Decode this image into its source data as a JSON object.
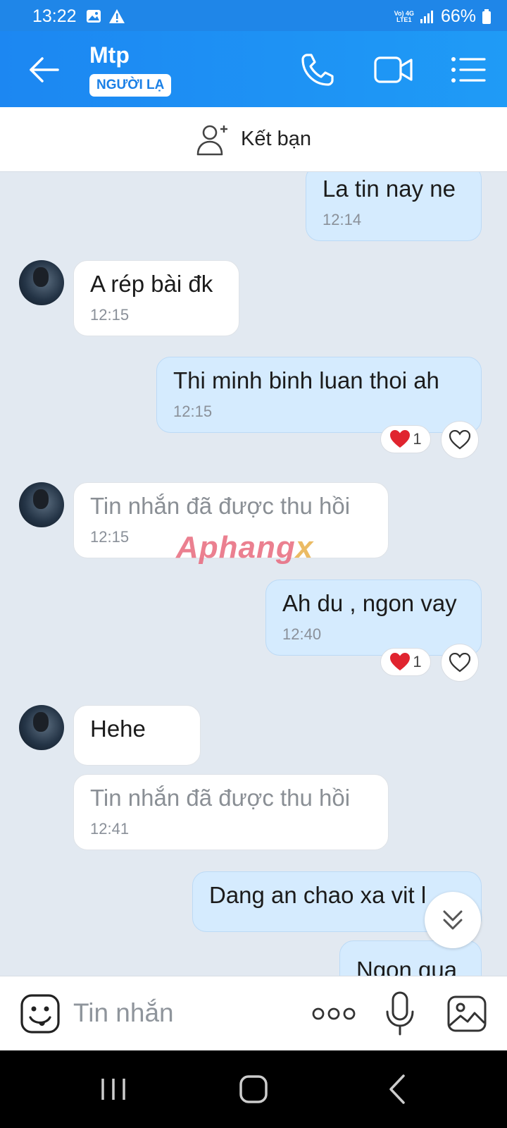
{
  "status_bar": {
    "time": "13:22",
    "net_line1": "Vo) 4G",
    "net_line2": "LTE1",
    "battery": "66%"
  },
  "header": {
    "contact_name": "Mtp",
    "badge": "NGƯỜI LẠ",
    "colors": {
      "header_bg": "#1f8ff0",
      "sent_bubble": "#d5ebfe",
      "received_bubble": "#ffffff",
      "chat_bg": "#e2e9f1"
    }
  },
  "friend_bar": {
    "label": "Kết bạn"
  },
  "messages": [
    {
      "direction": "sent",
      "text": "La tin nay ne",
      "time": "12:14"
    },
    {
      "direction": "received",
      "text": "A rép bài đk",
      "time": "12:15"
    },
    {
      "direction": "sent",
      "text": "Thi minh binh luan thoi ah",
      "time": "12:15",
      "reaction_count": "1"
    },
    {
      "direction": "received",
      "text": "Tin nhắn đã được thu hồi",
      "time": "12:15"
    },
    {
      "direction": "sent",
      "text": "Ah du , ngon vay",
      "time": "12:40",
      "reaction_count": "1"
    },
    {
      "direction": "received",
      "text": "Hehe",
      "time": ""
    },
    {
      "direction": "received",
      "text": "Tin nhắn đã được thu hồi",
      "time": "12:41"
    },
    {
      "direction": "sent",
      "text": "Dang an chao xa vit l",
      "time": ""
    },
    {
      "direction": "sent",
      "text": "Ngon qua",
      "time": ""
    }
  ],
  "watermark": {
    "part1": "Aphang",
    "part2": "x"
  },
  "input_bar": {
    "placeholder": "Tin nhắn",
    "icons": [
      "emoji-icon",
      "more-dots-icon",
      "microphone-icon",
      "image-icon"
    ]
  },
  "nav_bar": {
    "icons": [
      "recents-icon",
      "home-icon",
      "back-icon"
    ]
  }
}
